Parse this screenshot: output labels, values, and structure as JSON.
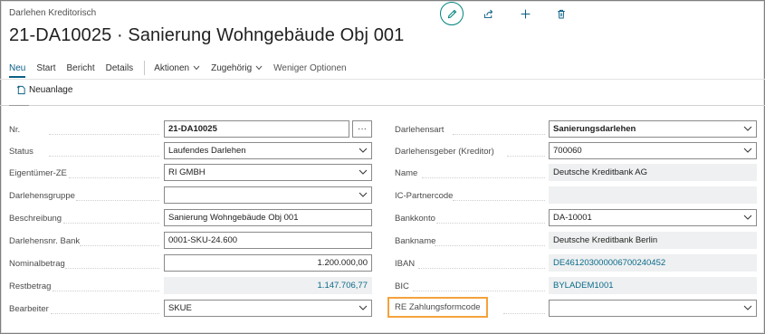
{
  "header": {
    "breadcrumb": "Darlehen Kreditorisch",
    "title": "21-DA10025 · Sanierung Wohngebäude Obj 001"
  },
  "actions": {
    "edit_icon": "pencil-icon",
    "share_icon": "share-icon",
    "add_icon": "plus-icon",
    "delete_icon": "trash-icon"
  },
  "menu": {
    "items": [
      "Neu",
      "Start",
      "Bericht",
      "Details"
    ],
    "actions_label": "Aktionen",
    "related_label": "Zugehörig",
    "fewer_label": "Weniger Optionen"
  },
  "toolbar": {
    "new_label": "Neuanlage"
  },
  "left_fields": [
    {
      "label": "Nr.",
      "value": "21-DA10025"
    },
    {
      "label": "Status",
      "value": "Laufendes Darlehen"
    },
    {
      "label": "Eigentümer-ZE",
      "value": "RI GMBH"
    },
    {
      "label": "Darlehensgruppe",
      "value": ""
    },
    {
      "label": "Beschreibung",
      "value": "Sanierung Wohngebäude Obj 001"
    },
    {
      "label": "Darlehensnr. Bank",
      "value": "0001-SKU-24.600"
    },
    {
      "label": "Nominalbetrag",
      "value": "1.200.000,00"
    },
    {
      "label": "Restbetrag",
      "value": "1.147.706,77"
    },
    {
      "label": "Bearbeiter",
      "value": "SKUE"
    }
  ],
  "right_fields": [
    {
      "label": "Darlehensart",
      "value": "Sanierungsdarlehen"
    },
    {
      "label": "Darlehensgeber (Kreditor)",
      "value": "700060"
    },
    {
      "label": "Name",
      "value": "Deutsche Kreditbank AG"
    },
    {
      "label": "IC-Partnercode",
      "value": ""
    },
    {
      "label": "Bankkonto",
      "value": "DA-10001"
    },
    {
      "label": "Bankname",
      "value": "Deutsche Kreditbank Berlin"
    },
    {
      "label": "IBAN",
      "value": "DE46120300000670024045​2"
    },
    {
      "label": "BIC",
      "value": "BYLADEM1001"
    },
    {
      "label": "RE Zahlungsformcode",
      "value": ""
    }
  ],
  "colors": {
    "accent": "#0a5f85",
    "highlight": "#f5a23c",
    "edit_ring": "#00857d"
  }
}
